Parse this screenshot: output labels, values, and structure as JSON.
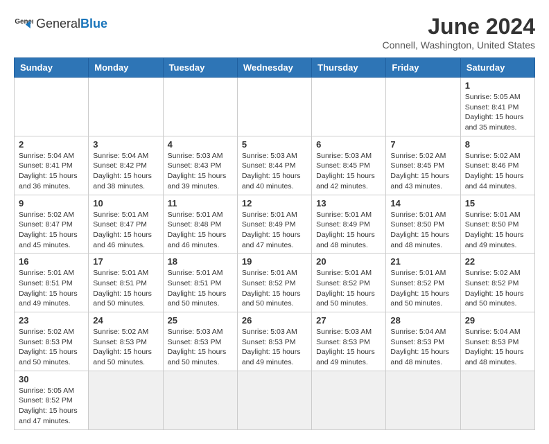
{
  "header": {
    "logo_general": "General",
    "logo_blue": "Blue",
    "month_title": "June 2024",
    "subtitle": "Connell, Washington, United States"
  },
  "days_of_week": [
    "Sunday",
    "Monday",
    "Tuesday",
    "Wednesday",
    "Thursday",
    "Friday",
    "Saturday"
  ],
  "weeks": [
    [
      {
        "day": "",
        "info": ""
      },
      {
        "day": "",
        "info": ""
      },
      {
        "day": "",
        "info": ""
      },
      {
        "day": "",
        "info": ""
      },
      {
        "day": "",
        "info": ""
      },
      {
        "day": "",
        "info": ""
      },
      {
        "day": "1",
        "info": "Sunrise: 5:05 AM\nSunset: 8:41 PM\nDaylight: 15 hours and 35 minutes."
      }
    ],
    [
      {
        "day": "2",
        "info": "Sunrise: 5:04 AM\nSunset: 8:41 PM\nDaylight: 15 hours and 36 minutes."
      },
      {
        "day": "3",
        "info": "Sunrise: 5:04 AM\nSunset: 8:42 PM\nDaylight: 15 hours and 38 minutes."
      },
      {
        "day": "4",
        "info": "Sunrise: 5:03 AM\nSunset: 8:43 PM\nDaylight: 15 hours and 39 minutes."
      },
      {
        "day": "5",
        "info": "Sunrise: 5:03 AM\nSunset: 8:44 PM\nDaylight: 15 hours and 40 minutes."
      },
      {
        "day": "6",
        "info": "Sunrise: 5:03 AM\nSunset: 8:45 PM\nDaylight: 15 hours and 42 minutes."
      },
      {
        "day": "7",
        "info": "Sunrise: 5:02 AM\nSunset: 8:45 PM\nDaylight: 15 hours and 43 minutes."
      },
      {
        "day": "8",
        "info": "Sunrise: 5:02 AM\nSunset: 8:46 PM\nDaylight: 15 hours and 44 minutes."
      }
    ],
    [
      {
        "day": "9",
        "info": "Sunrise: 5:02 AM\nSunset: 8:47 PM\nDaylight: 15 hours and 45 minutes."
      },
      {
        "day": "10",
        "info": "Sunrise: 5:01 AM\nSunset: 8:47 PM\nDaylight: 15 hours and 46 minutes."
      },
      {
        "day": "11",
        "info": "Sunrise: 5:01 AM\nSunset: 8:48 PM\nDaylight: 15 hours and 46 minutes."
      },
      {
        "day": "12",
        "info": "Sunrise: 5:01 AM\nSunset: 8:49 PM\nDaylight: 15 hours and 47 minutes."
      },
      {
        "day": "13",
        "info": "Sunrise: 5:01 AM\nSunset: 8:49 PM\nDaylight: 15 hours and 48 minutes."
      },
      {
        "day": "14",
        "info": "Sunrise: 5:01 AM\nSunset: 8:50 PM\nDaylight: 15 hours and 48 minutes."
      },
      {
        "day": "15",
        "info": "Sunrise: 5:01 AM\nSunset: 8:50 PM\nDaylight: 15 hours and 49 minutes."
      }
    ],
    [
      {
        "day": "16",
        "info": "Sunrise: 5:01 AM\nSunset: 8:51 PM\nDaylight: 15 hours and 49 minutes."
      },
      {
        "day": "17",
        "info": "Sunrise: 5:01 AM\nSunset: 8:51 PM\nDaylight: 15 hours and 50 minutes."
      },
      {
        "day": "18",
        "info": "Sunrise: 5:01 AM\nSunset: 8:51 PM\nDaylight: 15 hours and 50 minutes."
      },
      {
        "day": "19",
        "info": "Sunrise: 5:01 AM\nSunset: 8:52 PM\nDaylight: 15 hours and 50 minutes."
      },
      {
        "day": "20",
        "info": "Sunrise: 5:01 AM\nSunset: 8:52 PM\nDaylight: 15 hours and 50 minutes."
      },
      {
        "day": "21",
        "info": "Sunrise: 5:01 AM\nSunset: 8:52 PM\nDaylight: 15 hours and 50 minutes."
      },
      {
        "day": "22",
        "info": "Sunrise: 5:02 AM\nSunset: 8:52 PM\nDaylight: 15 hours and 50 minutes."
      }
    ],
    [
      {
        "day": "23",
        "info": "Sunrise: 5:02 AM\nSunset: 8:53 PM\nDaylight: 15 hours and 50 minutes."
      },
      {
        "day": "24",
        "info": "Sunrise: 5:02 AM\nSunset: 8:53 PM\nDaylight: 15 hours and 50 minutes."
      },
      {
        "day": "25",
        "info": "Sunrise: 5:03 AM\nSunset: 8:53 PM\nDaylight: 15 hours and 50 minutes."
      },
      {
        "day": "26",
        "info": "Sunrise: 5:03 AM\nSunset: 8:53 PM\nDaylight: 15 hours and 49 minutes."
      },
      {
        "day": "27",
        "info": "Sunrise: 5:03 AM\nSunset: 8:53 PM\nDaylight: 15 hours and 49 minutes."
      },
      {
        "day": "28",
        "info": "Sunrise: 5:04 AM\nSunset: 8:53 PM\nDaylight: 15 hours and 48 minutes."
      },
      {
        "day": "29",
        "info": "Sunrise: 5:04 AM\nSunset: 8:53 PM\nDaylight: 15 hours and 48 minutes."
      }
    ],
    [
      {
        "day": "30",
        "info": "Sunrise: 5:05 AM\nSunset: 8:52 PM\nDaylight: 15 hours and 47 minutes."
      },
      {
        "day": "",
        "info": ""
      },
      {
        "day": "",
        "info": ""
      },
      {
        "day": "",
        "info": ""
      },
      {
        "day": "",
        "info": ""
      },
      {
        "day": "",
        "info": ""
      },
      {
        "day": "",
        "info": ""
      }
    ]
  ]
}
